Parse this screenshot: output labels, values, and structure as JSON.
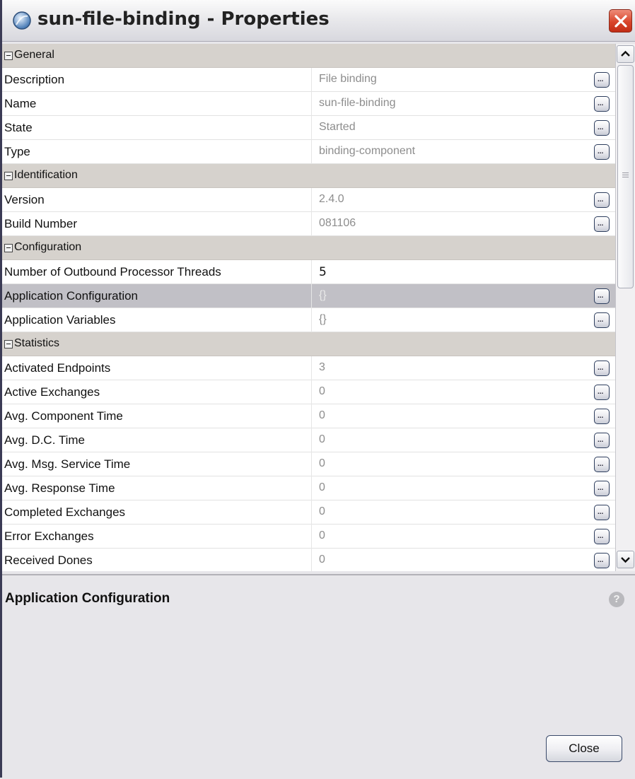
{
  "window": {
    "title": "sun-file-binding - Properties",
    "icons": {
      "app": "component-sphere-icon",
      "close": "close-x-icon",
      "help": "help-icon",
      "edit": "ellipsis-icon"
    }
  },
  "sections": [
    {
      "label": "General",
      "rows": [
        {
          "name": "Description",
          "value": "File binding"
        },
        {
          "name": "Name",
          "value": "sun-file-binding"
        },
        {
          "name": "State",
          "value": "Started"
        },
        {
          "name": "Type",
          "value": "binding-component"
        }
      ]
    },
    {
      "label": "Identification",
      "rows": [
        {
          "name": "Version",
          "value": "2.4.0"
        },
        {
          "name": "Build Number",
          "value": "081106"
        }
      ]
    },
    {
      "label": "Configuration",
      "rows": [
        {
          "name": "Number of Outbound Processor Threads",
          "value": "5"
        },
        {
          "name": "Application Configuration",
          "value": "{}"
        },
        {
          "name": "Application Variables",
          "value": "{}"
        }
      ]
    },
    {
      "label": "Statistics",
      "rows": [
        {
          "name": "Activated Endpoints",
          "value": "3"
        },
        {
          "name": "Active Exchanges",
          "value": "0"
        },
        {
          "name": "Avg. Component Time",
          "value": "0"
        },
        {
          "name": "Avg. D.C. Time",
          "value": "0"
        },
        {
          "name": "Avg. Msg. Service Time",
          "value": "0"
        },
        {
          "name": "Avg. Response Time",
          "value": "0"
        },
        {
          "name": "Completed Exchanges",
          "value": "0"
        },
        {
          "name": "Error Exchanges",
          "value": "0"
        },
        {
          "name": "Received Dones",
          "value": "0"
        }
      ]
    }
  ],
  "description": {
    "title": "Application Configuration",
    "help_glyph": "?"
  },
  "buttons": {
    "close": "Close"
  },
  "colors": {
    "category_bg": "#d6d2cd",
    "selected_row_bg": "#c1c0c6",
    "close_button_red": "#d9452b"
  }
}
